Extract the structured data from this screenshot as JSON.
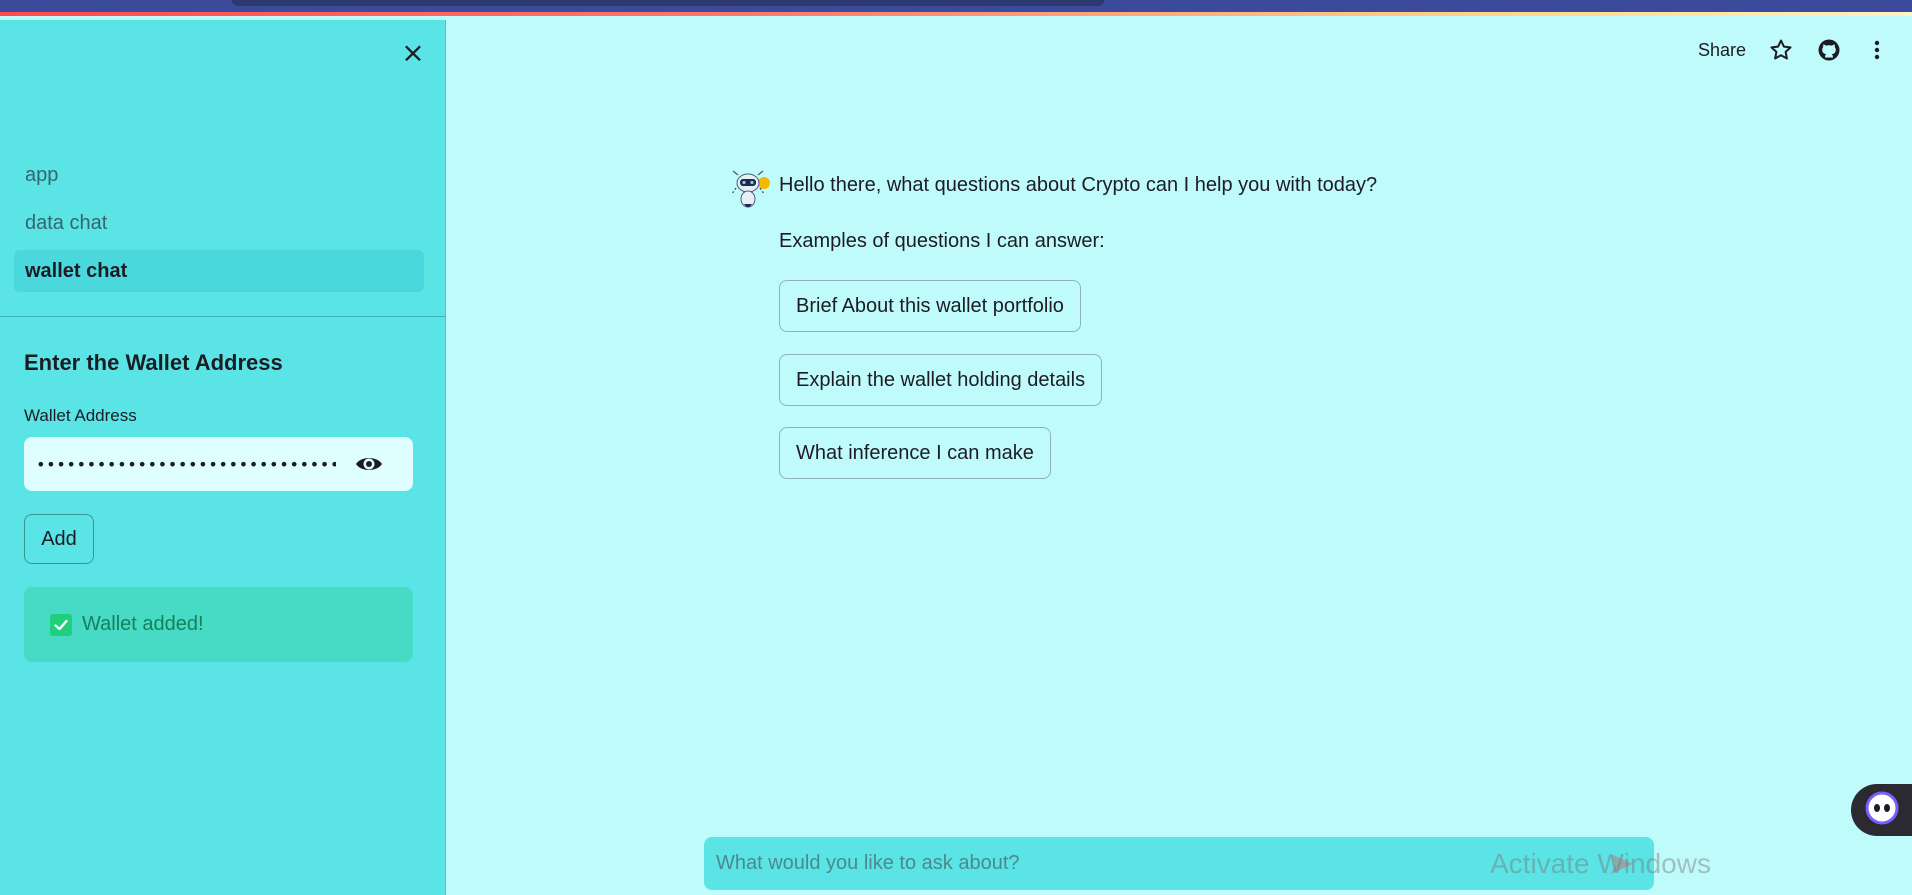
{
  "window": {
    "close_icon": "×"
  },
  "sidebar": {
    "nav_items": [
      {
        "label": "app",
        "active": false
      },
      {
        "label": "data chat",
        "active": false
      },
      {
        "label": "wallet chat",
        "active": true
      }
    ],
    "section_title": "Enter the Wallet Address",
    "wallet_field": {
      "label": "Wallet Address",
      "masked_value": "••••••••••••••••••••••••••••••••••••••••••"
    },
    "add_label": "Add",
    "success_message": "Wallet added!"
  },
  "toolbar": {
    "share_label": "Share",
    "icons": [
      "star-icon",
      "github-icon",
      "more-vertical-icon"
    ]
  },
  "chat": {
    "greeting": "Hello there, what questions about Crypto can I help you with today?",
    "examples_title": "Examples of questions I can answer:",
    "examples": [
      "Brief About this wallet portfolio",
      "Explain the wallet holding details",
      "What inference I can make"
    ],
    "input_placeholder": "What would you like to ask about?"
  },
  "os": {
    "watermark": "Activate Windows"
  },
  "colors": {
    "sidebar_bg": "#5ae4e6",
    "main_bg": "#c0fbfc",
    "success_bg": "#47dbc6",
    "success_text": "#17805a",
    "check": "#1fcf7c"
  }
}
